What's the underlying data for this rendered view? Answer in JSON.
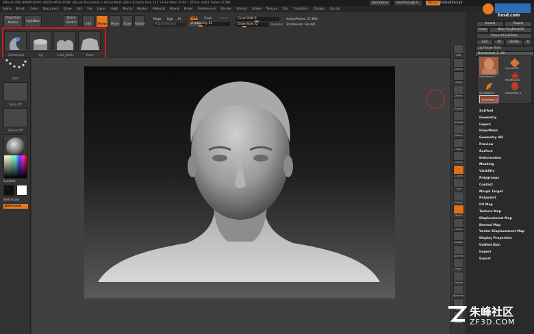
{
  "titlebar": {
    "text": "ZBrush 4R6 [HRBN-DOPF-QODX-HKQI-HY38]   ZBrush Document   • Active Mem 336 • Scratch Disk 111 • Free Mem 3794 • ZTime 3.681 Timers 0.084",
    "quicksave": "QuickSave",
    "seethrough": "See-through  0",
    "menus_label": "Menus",
    "defaultscript": "DefaultZScript"
  },
  "menubar": [
    "Alpha",
    "Brush",
    "Color",
    "Document",
    "Draw",
    "Edit",
    "File",
    "Layer",
    "Light",
    "Macro",
    "Marker",
    "Material",
    "Movie",
    "Picker",
    "Preferences",
    "Render",
    "Stencil",
    "Stroke",
    "Texture",
    "Tool",
    "Transform",
    "Zplugin",
    "Zscript"
  ],
  "topshelf": {
    "projection": "Projection\nMaster",
    "lightbox": "LightBox",
    "quicksketch": "Quick\nSketch",
    "edit": "Edit",
    "draw": "Draw",
    "move": "Move",
    "scale": "Scale",
    "rotate": "Rotate",
    "mrgb": "Mrgb",
    "rgb": "Rgb",
    "m": "M",
    "rgb_intensity": "Rgb Intensity",
    "zadd": "Zadd",
    "zsub": "Zsub",
    "zcut": "Zcut",
    "z_intensity": "Z Intensity 25",
    "focal_shift": "Focal Shift 0",
    "draw_size": "Draw Size 32",
    "dynamic": "Dynamic",
    "active_points": "ActivePoints: 57,895",
    "total_points": "TotalPoints: 69,285"
  },
  "recent_tools": [
    "DemoHead",
    "Cyl",
    "Cube_Profile",
    "Plane"
  ],
  "leftpanel": {
    "captions": [
      "",
      "Dots",
      "Alpha Off",
      "Texture Off",
      "MatCap"
    ],
    "gradient": "Gradient",
    "switchcolor": "SwitchColor",
    "alternate": "Alternate"
  },
  "rightstrip": [
    "BPR",
    "SPix 3",
    "Scroll",
    "Zoom",
    "Actual",
    "AAHalf",
    "Persp",
    "Floor",
    "Local",
    "L.Sym",
    "Xyz",
    "Frame",
    "Move",
    "Scale",
    "Rotate",
    "Line Fill",
    "PolyF",
    "Transp",
    "Dynamic",
    "Solo",
    "Xpose"
  ],
  "toolpanel": {
    "import": "Import",
    "export": "Export",
    "clone": "Clone",
    "make_polymesh": "Make PolyMesh3D",
    "clone_all": "Clone All SubTools",
    "goz": "GoZ",
    "all": "All",
    "visible": "Visible",
    "r": "R",
    "lightbox_tools": "Lightbox▸ Tools",
    "current_tool": "DemoHead_2. 48",
    "thumbs": [
      "DemoHead_2",
      "Cylinder3D",
      "PolyMesh3D",
      "SimpleBrush",
      "DemoHead_1",
      "DemoHead_2"
    ],
    "menu": [
      "SubTool",
      "Geometry",
      "Layers",
      "FiberMesh",
      "Geometry HD",
      "Preview",
      "Surface",
      "Deformation",
      "Masking",
      "Visibility",
      "Polygroups",
      "Contact",
      "Morph Target",
      "Polypaint",
      "UV Map",
      "Texture Map",
      "Displacement Map",
      "Normal Map",
      "Vector Displacement Map",
      "Display Properties",
      "Unified Skin",
      "Import",
      "Export"
    ]
  },
  "watermark": {
    "top": "hxsd.com",
    "brand": "ZF3D.COM",
    "brand_cn": "朱峰社区"
  }
}
